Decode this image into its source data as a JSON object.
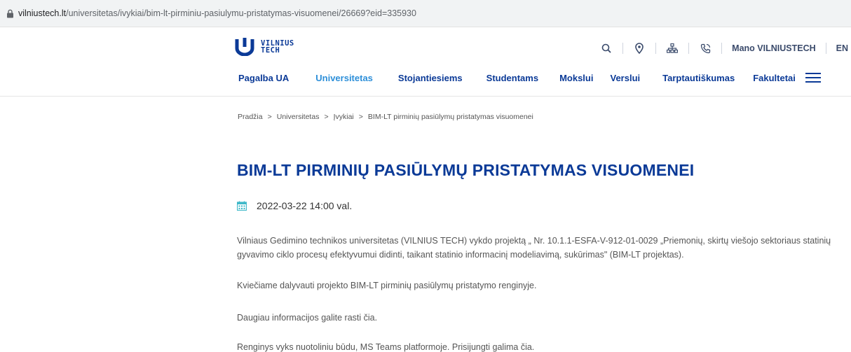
{
  "browser": {
    "url_domain": "vilniustech.lt",
    "url_path": "/universitetas/ivykiai/bim-lt-pirminiu-pasiulymu-pristatymas-visuomenei/26669?eid=335930"
  },
  "header": {
    "logo_line1": "VILNIUS",
    "logo_line2": "TECH",
    "mano_label": "Mano VILNIUSTECH",
    "lang_label": "EN",
    "nav": [
      {
        "label": "Pagalba UA"
      },
      {
        "label": "Universitetas"
      },
      {
        "label": "Stojantiesiems"
      },
      {
        "label": "Studentams"
      },
      {
        "label": "Mokslui"
      },
      {
        "label": "Verslui"
      },
      {
        "label": "Tarptautiškumas"
      },
      {
        "label": "Fakultetai"
      }
    ]
  },
  "breadcrumb": [
    "Pradžia",
    "Universitetas",
    "Įvykiai",
    "BIM-LT pirminių pasiūlymų pristatymas visuomenei"
  ],
  "article": {
    "title": "BIM-LT PIRMINIŲ PASIŪLYMŲ PRISTATYMAS VISUOMENEI",
    "date": "2022-03-22 14:00 val.",
    "paragraphs": [
      "Vilniaus Gedimino technikos universitetas (VILNIUS TECH) vykdo projektą „ Nr. 10.1.1-ESFA-V-912-01-0029 „Priemonių, skirtų viešojo sektoriaus statinių gyvavimo ciklo procesų efektyvumui didinti, taikant statinio informacinį modeliavimą, sukūrimas\" (BIM-LT projektas).",
      "Kviečiame dalyvauti projekto BIM-LT pirminių pasiūlymų pristatymo renginyje.",
      "Daugiau informacijos galite rasti čia.",
      "Renginys vyks nuotoliniu būdu, MS Teams platformoje. Prisijungti galima čia."
    ]
  },
  "colors": {
    "brand_blue": "#0b3a97",
    "active_blue": "#2d8fd9",
    "calendar_teal": "#3fb8c8"
  }
}
